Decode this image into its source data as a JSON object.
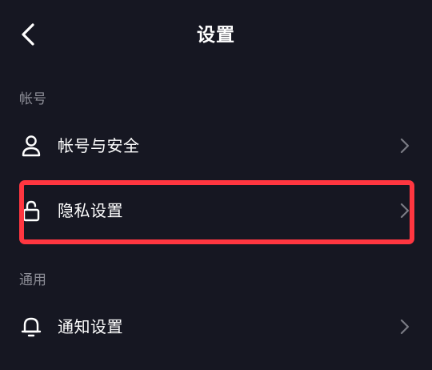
{
  "header": {
    "title": "设置",
    "back_icon": "chevron-left-icon"
  },
  "sections": [
    {
      "label": "帐号",
      "items": [
        {
          "label": "帐号与安全",
          "icon": "user-icon"
        },
        {
          "label": "隐私设置",
          "icon": "lock-icon",
          "highlighted": true
        }
      ]
    },
    {
      "label": "通用",
      "items": [
        {
          "label": "通知设置",
          "icon": "bell-icon"
        }
      ]
    }
  ],
  "colors": {
    "background": "#161722",
    "text": "#ffffff",
    "section_label": "#8c8d96",
    "chevron": "#7a7b84",
    "highlight_border": "#ff3640"
  }
}
